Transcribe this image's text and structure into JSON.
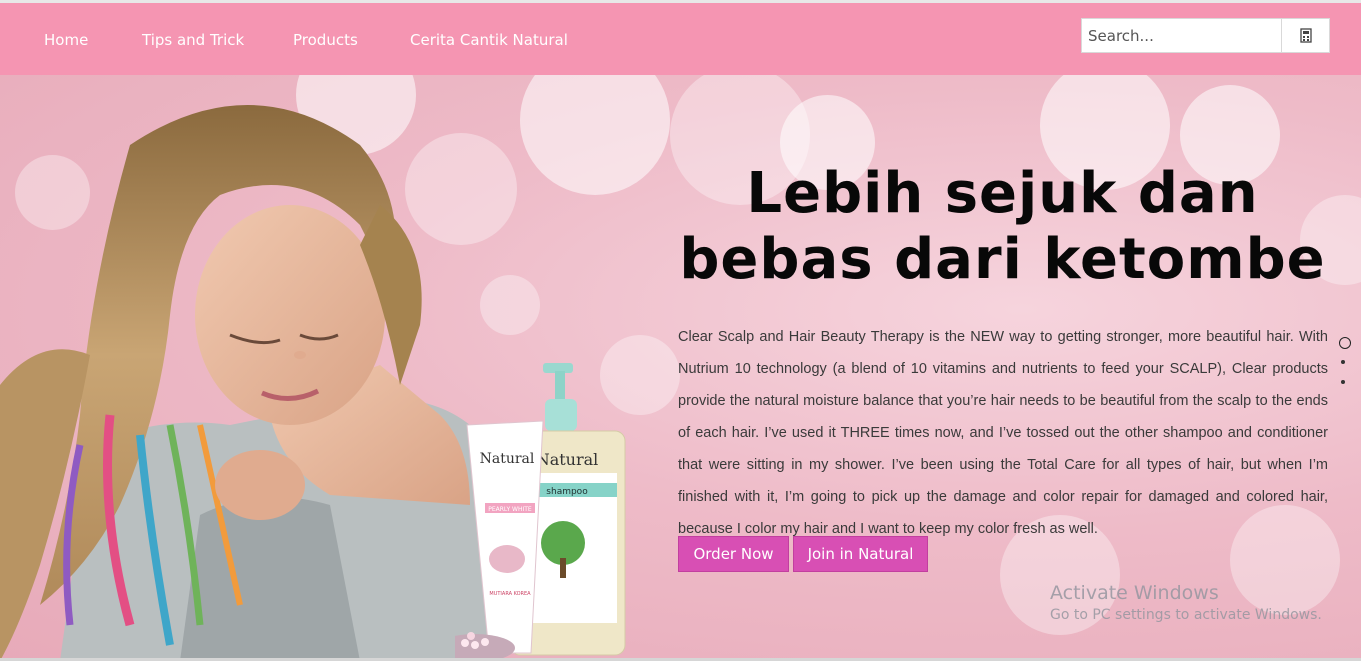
{
  "nav": {
    "items": [
      {
        "label": "Home"
      },
      {
        "label": "Tips and Trick"
      },
      {
        "label": "Products"
      },
      {
        "label": "Cerita Cantik Natural"
      }
    ],
    "background": "#f595b2"
  },
  "search": {
    "placeholder": "Search...",
    "value": "",
    "button_icon": "search-button-icon"
  },
  "hero": {
    "headline": "Lebih sejuk dan bebas dari ketombe",
    "paragraph": "Clear Scalp and Hair Beauty Therapy is the NEW way to getting stronger, more beautiful hair. With Nutrium 10 technology (a blend of 10 vitamins and nutrients to feed your SCALP), Clear products provide the natural moisture balance that you’re hair needs to be beautiful from the scalp to the ends of each hair. I’ve used it THREE times now, and I’ve tossed out the other shampoo and conditioner that were sitting in my shower. I’ve been using the Total Care for all types of hair, but when I’m finished with it, I’m going to pick up the damage and color repair for damaged and colored hair, because I color my hair and I want to keep my color fresh as well.",
    "buttons": {
      "order": "Order Now",
      "join": "Join in Natural"
    },
    "button_color": "#d84fb4",
    "slides": {
      "count": 3,
      "active": 1
    }
  },
  "products": {
    "tube_brand": "Natural",
    "tube_label": "PEARLY WHITE",
    "tube_sub": "MUTIARA KOREA",
    "bottle_brand": "Natural",
    "bottle_label": "shampoo"
  },
  "watermark": {
    "title": "Activate Windows",
    "subtitle": "Go to PC settings to activate Windows."
  }
}
